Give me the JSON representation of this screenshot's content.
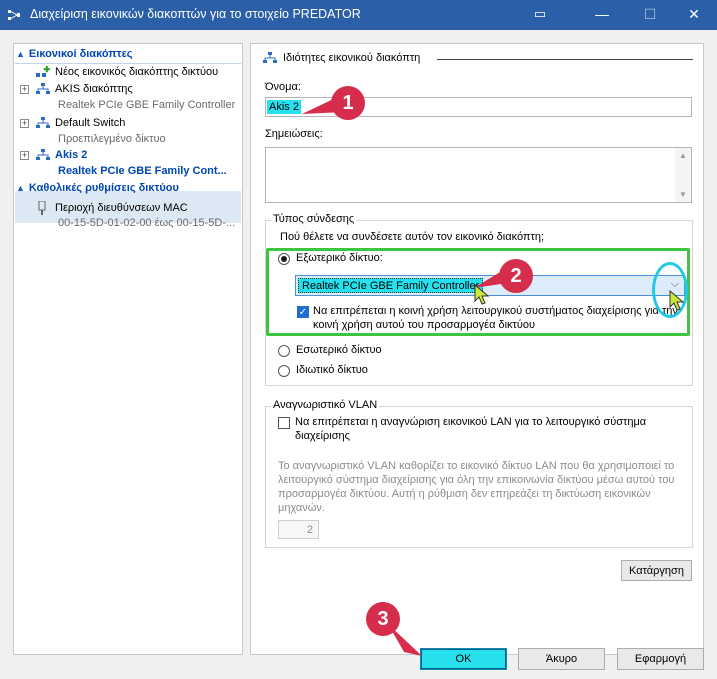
{
  "window": {
    "title": "Διαχείριση εικονικών διακοπτών για το στοιχείο PREDATOR",
    "min_symbol": "—",
    "max_symbol": "☐",
    "close_symbol": "✕",
    "extra_symbol": "▭"
  },
  "tree": {
    "section_switches": "Εικονικοί διακόπτες",
    "new_switch": "Νέος εικονικός διακόπτης δικτύου",
    "items": [
      {
        "name": "AKIS διακόπτης",
        "sub": "Realtek PCIe GBE Family Controller"
      },
      {
        "name": "Default Switch",
        "sub": "Προεπιλεγμένο δίκτυο"
      },
      {
        "name": "Akis 2",
        "sub": "Realtek PCIe GBE Family Cont..."
      }
    ],
    "section_global": "Καθολικές ρυθμίσεις δικτύου",
    "mac_name": "Περιοχή διευθύνσεων MAC",
    "mac_sub": "00-15-5D-01-02-00 έως 00-15-5D-..."
  },
  "panel": {
    "header": "Ιδιότητες εικονικού διακόπτη",
    "name_label": "Όνομα:",
    "name_value": "Akis 2",
    "notes_label": "Σημειώσεις:",
    "connection_group": "Τύπος σύνδεσης",
    "connection_question": "Πού θέλετε να συνδέσετε αυτόν τον εικονικό διακόπτη;",
    "external_label": "Εξωτερικό δίκτυο:",
    "adapter_value": "Realtek PCIe GBE Family Controller",
    "allow_share_line1": "Να επιτρέπεται η κοινή χρήση λειτουργικού συστήματος διαχείρισης για την",
    "allow_share_line2": "κοινή χρήση αυτού του προσαρμογέα δικτύου",
    "internal_label": "Εσωτερικό δίκτυο",
    "private_label": "Ιδιωτικό δίκτυο",
    "vlan_group": "Αναγνωριστικό VLAN",
    "vlan_check_line1": "Να επιτρέπεται η αναγνώριση εικονικού LAN για το λειτουργικό σύστημα",
    "vlan_check_line2": "διαχείρισης",
    "vlan_desc_lines": [
      "Το αναγνωριστικό VLAN καθορίζει το εικονικό δίκτυο LAN που θα χρησιμοποιεί το",
      "λειτουργικό σύστημα διαχείρισης για όλη την επικοινωνία δικτύου μέσω αυτού του",
      "προσαρμογέα δικτύου. Αυτή η ρύθμιση δεν επηρεάζει τη δικτύωση εικονικών",
      "μηχανών."
    ],
    "vlan_value": "2",
    "remove_button": "Κατάργηση"
  },
  "buttons": {
    "ok": "OK",
    "cancel": "Άκυρο",
    "apply": "Εφαρμογή"
  },
  "annotations": {
    "marker1": "1",
    "marker2": "2",
    "marker3": "3",
    "color_marker": "#d62d4c",
    "color_ring": "#23c8e6",
    "color_box": "#3ec53e"
  },
  "colors": {
    "titlebar": "#2b5fa8",
    "accent": "#0046b4",
    "ok_button": "#27e0ee",
    "name_highlight": "#27e0ee"
  }
}
